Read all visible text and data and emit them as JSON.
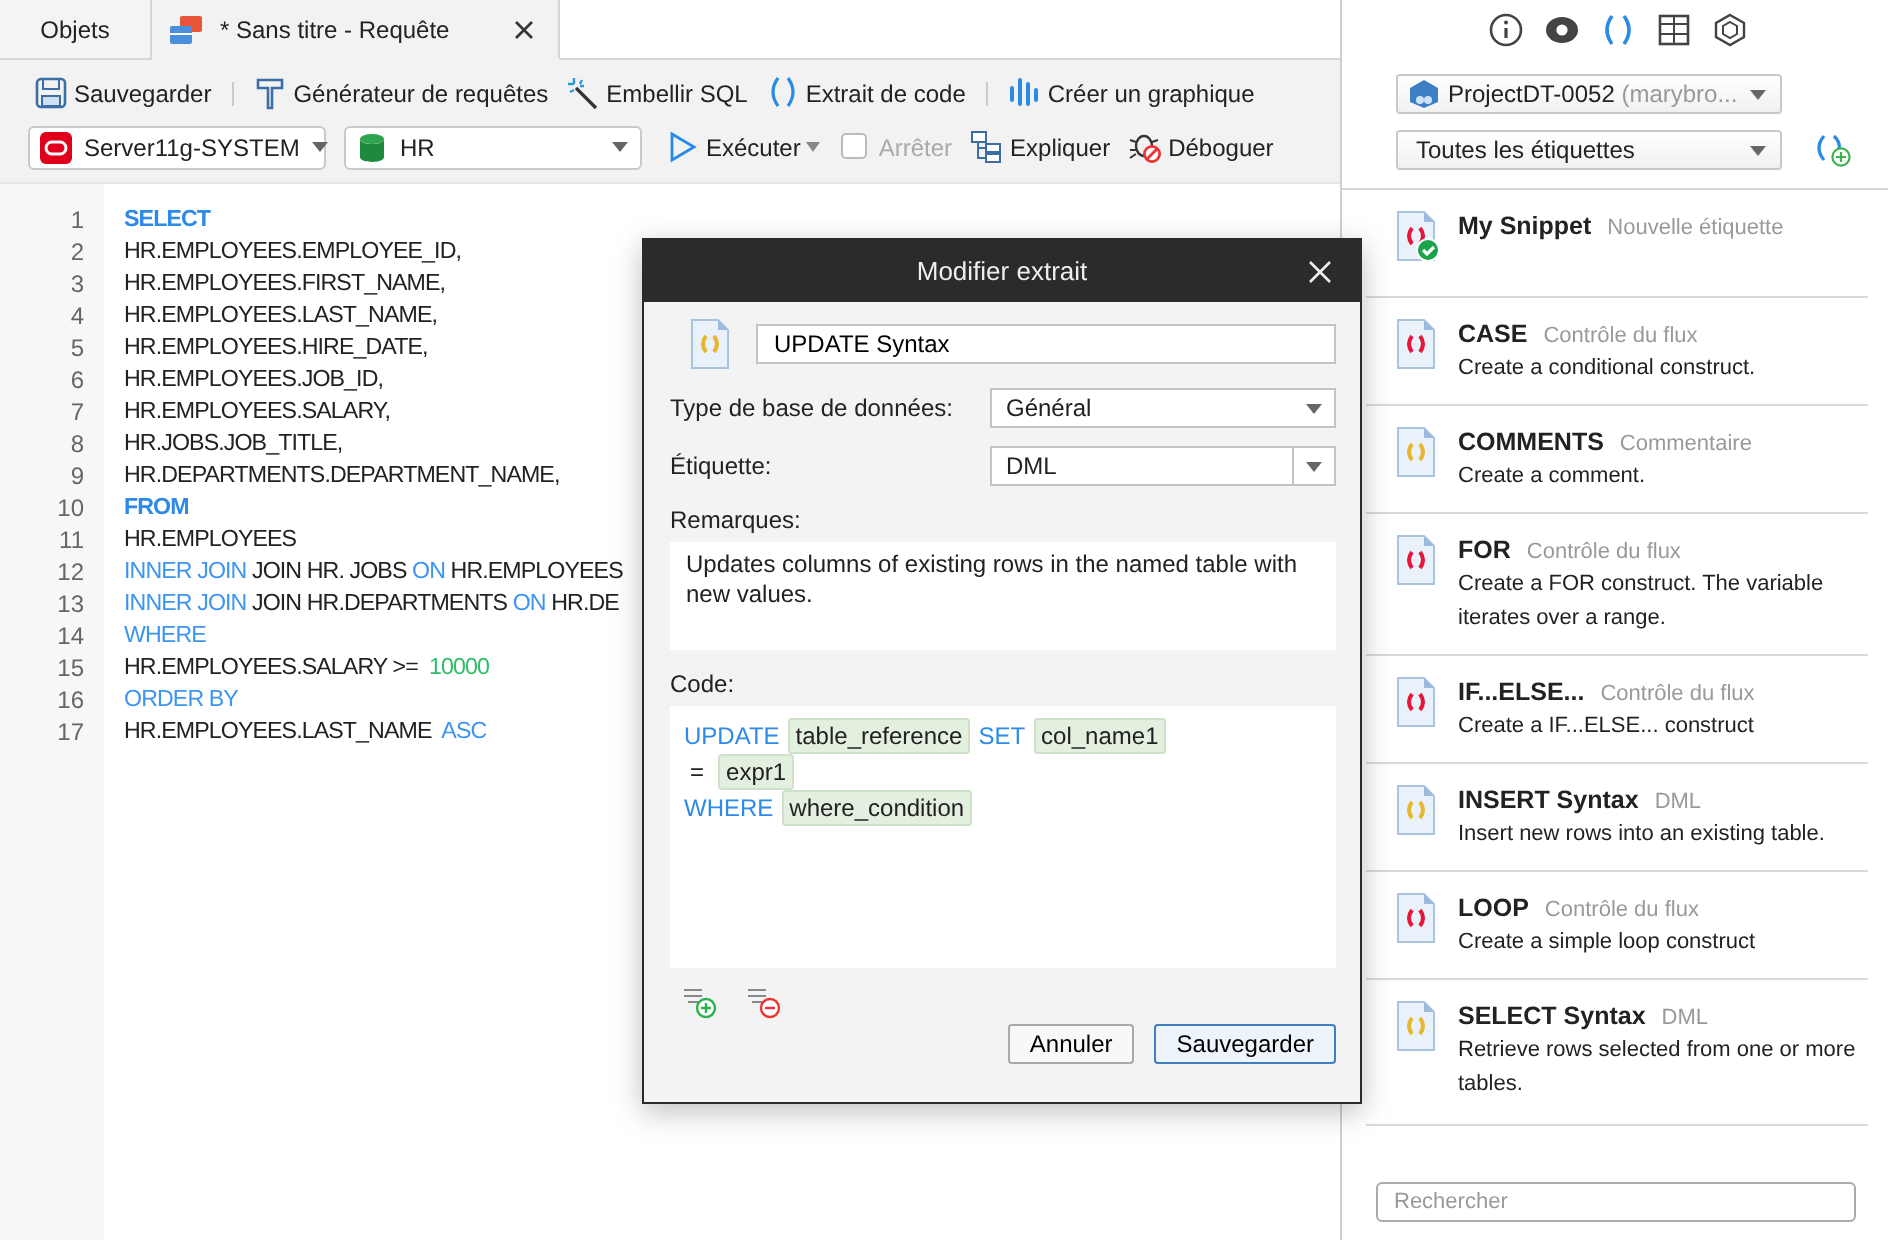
{
  "tabs": [
    {
      "label": "Objets",
      "selected": false
    },
    {
      "label": "* Sans titre - Requête",
      "selected": true
    }
  ],
  "toolbar": {
    "buttons": [
      {
        "kind": "save",
        "label": "Sauvegarder"
      },
      {
        "kind": "builder",
        "label": "Générateur de requêtes"
      },
      {
        "kind": "beautify",
        "label": "Embellir SQL"
      },
      {
        "kind": "snippet",
        "label": "Extrait de code"
      },
      {
        "kind": "chart",
        "label": "Créer un graphique"
      }
    ],
    "connection": "Server11g-SYSTEM",
    "database": "HR",
    "actions": [
      {
        "kind": "run",
        "label": "Exécuter",
        "disabled": false
      },
      {
        "kind": "stop",
        "label": "Arrêter",
        "disabled": true
      },
      {
        "kind": "explain",
        "label": "Expliquer",
        "disabled": false
      },
      {
        "kind": "debug",
        "label": "Déboguer",
        "disabled": false
      }
    ]
  },
  "editor": {
    "lines": [
      {
        "number": "1",
        "tokens": [
          {
            "kind": "clause",
            "text": "SELECT"
          }
        ]
      },
      {
        "number": "2",
        "tokens": [
          {
            "kind": "plain",
            "text": "HR.EMPLOYEES.EMPLOYEE_ID,"
          }
        ]
      },
      {
        "number": "3",
        "tokens": [
          {
            "kind": "plain",
            "text": "HR.EMPLOYEES.FIRST_NAME,"
          }
        ]
      },
      {
        "number": "4",
        "tokens": [
          {
            "kind": "plain",
            "text": "HR.EMPLOYEES.LAST_NAME,"
          }
        ]
      },
      {
        "number": "5",
        "tokens": [
          {
            "kind": "plain",
            "text": "HR.EMPLOYEES.HIRE_DATE,"
          }
        ]
      },
      {
        "number": "6",
        "tokens": [
          {
            "kind": "plain",
            "text": "HR.EMPLOYEES.JOB_ID,"
          }
        ]
      },
      {
        "number": "7",
        "tokens": [
          {
            "kind": "plain",
            "text": "HR.EMPLOYEES.SALARY,"
          }
        ]
      },
      {
        "number": "8",
        "tokens": [
          {
            "kind": "plain",
            "text": "HR.JOBS.JOB_TITLE,"
          }
        ]
      },
      {
        "number": "9",
        "tokens": [
          {
            "kind": "plain",
            "text": "HR.DEPARTMENTS.DEPARTMENT_NAME,"
          }
        ]
      },
      {
        "number": "10",
        "tokens": [
          {
            "kind": "clause",
            "text": "FROM"
          }
        ]
      },
      {
        "number": "11",
        "tokens": [
          {
            "kind": "plain",
            "text": "HR.EMPLOYEES"
          }
        ]
      },
      {
        "number": "12",
        "tokens": [
          {
            "kind": "keyword",
            "text": "INNER JOIN"
          },
          {
            "kind": "plain",
            "text": " JOIN HR. JOBS "
          },
          {
            "kind": "keyword",
            "text": "ON"
          },
          {
            "kind": "plain",
            "text": " HR.EMPLOYEES"
          }
        ]
      },
      {
        "number": "13",
        "tokens": [
          {
            "kind": "keyword",
            "text": "INNER JOIN"
          },
          {
            "kind": "plain",
            "text": " JOIN HR.DEPARTMENTS "
          },
          {
            "kind": "keyword",
            "text": "ON"
          },
          {
            "kind": "plain",
            "text": " HR.DE"
          }
        ]
      },
      {
        "number": "14",
        "tokens": [
          {
            "kind": "keyword",
            "text": "WHERE"
          }
        ]
      },
      {
        "number": "15",
        "tokens": [
          {
            "kind": "plain",
            "text": "HR.EMPLOYEES.SALARY >=  "
          },
          {
            "kind": "number",
            "text": "10000"
          }
        ]
      },
      {
        "number": "16",
        "tokens": [
          {
            "kind": "keyword",
            "text": "ORDER BY"
          }
        ]
      },
      {
        "number": "17",
        "tokens": [
          {
            "kind": "plain",
            "text": "HR.EMPLOYEES.LAST_NAME  "
          },
          {
            "kind": "keyword",
            "text": "ASC"
          }
        ]
      }
    ]
  },
  "dialog": {
    "title": "Modifier extrait",
    "name": "UPDATE Syntax",
    "fields": [
      {
        "kind": "combo",
        "label": "Type de base de données:",
        "value": "Général"
      },
      {
        "kind": "editable-combo",
        "label": "Étiquette:",
        "value": "DML"
      }
    ],
    "remarks_label": "Remarques:",
    "remarks": "Updates columns of existing rows in the named table with new values.",
    "code_label": "Code:",
    "code_lines": [
      [
        {
          "kind": "keyword",
          "text": "UPDATE"
        },
        {
          "kind": "placeholder",
          "text": "table_reference"
        },
        {
          "kind": "keyword",
          "text": "SET"
        },
        {
          "kind": "placeholder",
          "text": "col_name1"
        }
      ],
      [
        {
          "kind": "plain",
          "text": "="
        },
        {
          "kind": "placeholder",
          "text": "expr1"
        }
      ],
      [
        {
          "kind": "keyword",
          "text": "WHERE"
        },
        {
          "kind": "placeholder",
          "text": "where_condition"
        }
      ]
    ],
    "buttons": [
      {
        "label": "Annuler",
        "default": false
      },
      {
        "label": "Sauvegarder",
        "default": true
      }
    ]
  },
  "panel": {
    "tools": [
      {
        "kind": "info",
        "selected": false
      },
      {
        "kind": "preview",
        "selected": false
      },
      {
        "kind": "snippet",
        "selected": true
      },
      {
        "kind": "layout",
        "selected": false
      },
      {
        "kind": "model",
        "selected": false
      }
    ],
    "project": {
      "name": "ProjectDT-0052",
      "owner": "(marybro..."
    },
    "tag_filter": "Toutes les étiquettes",
    "snippets": [
      {
        "title": "My Snippet",
        "tag": "Nouvelle étiquette",
        "color": "#e8173a",
        "verified": true
      },
      {
        "title": "CASE",
        "tag": "Contrôle du flux",
        "description": "Create a conditional construct.",
        "color": "#e8173a",
        "verified": false
      },
      {
        "title": "COMMENTS",
        "tag": "Commentaire",
        "description": "Create a comment.",
        "color": "#e8b530",
        "verified": false
      },
      {
        "title": "FOR",
        "tag": "Contrôle du flux",
        "description": "Create a FOR construct. The variable iterates over a range.",
        "color": "#e8173a",
        "verified": false
      },
      {
        "title": "IF...ELSE...",
        "tag": "Contrôle du flux",
        "description": "Create a IF...ELSE... construct",
        "color": "#e8173a",
        "verified": false
      },
      {
        "title": "INSERT Syntax",
        "tag": "DML",
        "description": "Insert new rows into an existing table.",
        "color": "#e8b530",
        "verified": false
      },
      {
        "title": "LOOP",
        "tag": "Contrôle du flux",
        "description": "Create a simple loop construct",
        "color": "#e8173a",
        "verified": false
      },
      {
        "title": "SELECT Syntax",
        "tag": "DML",
        "description": "Retrieve rows selected from one or more tables.",
        "color": "#e8b530",
        "verified": false
      }
    ],
    "search": {
      "placeholder": "Rechercher"
    }
  }
}
